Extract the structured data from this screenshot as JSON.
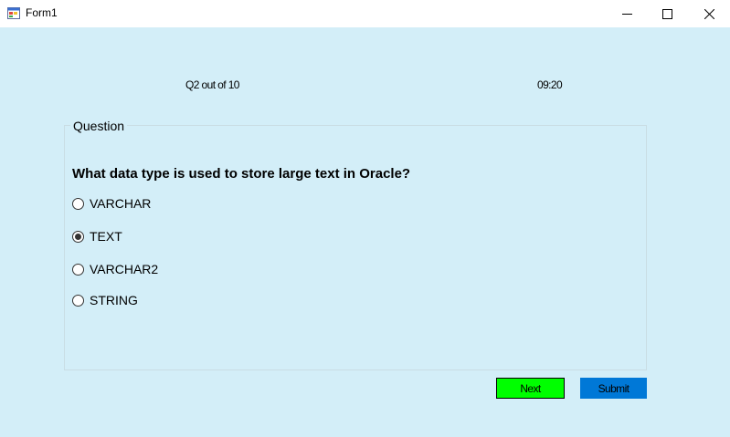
{
  "window": {
    "title": "Form1",
    "background_color": "#d3eef8"
  },
  "quiz": {
    "progress": "Q2 out of 10",
    "timer": "09:20",
    "group_title": "Question",
    "question": "What data type is used to store large text in Oracle?",
    "selected_option_index": 1,
    "options": [
      {
        "label": "VARCHAR",
        "checked": false
      },
      {
        "label": "TEXT",
        "checked": true
      },
      {
        "label": "VARCHAR2",
        "checked": false
      },
      {
        "label": "STRING",
        "checked": false
      }
    ]
  },
  "buttons": {
    "next": {
      "label": "Next",
      "color": "#00ff00"
    },
    "submit": {
      "label": "Submit",
      "color": "#0078d7"
    }
  },
  "icons": {
    "app": "winforms-app-icon",
    "minimize": "minimize-icon",
    "maximize": "maximize-icon",
    "close": "close-icon"
  }
}
